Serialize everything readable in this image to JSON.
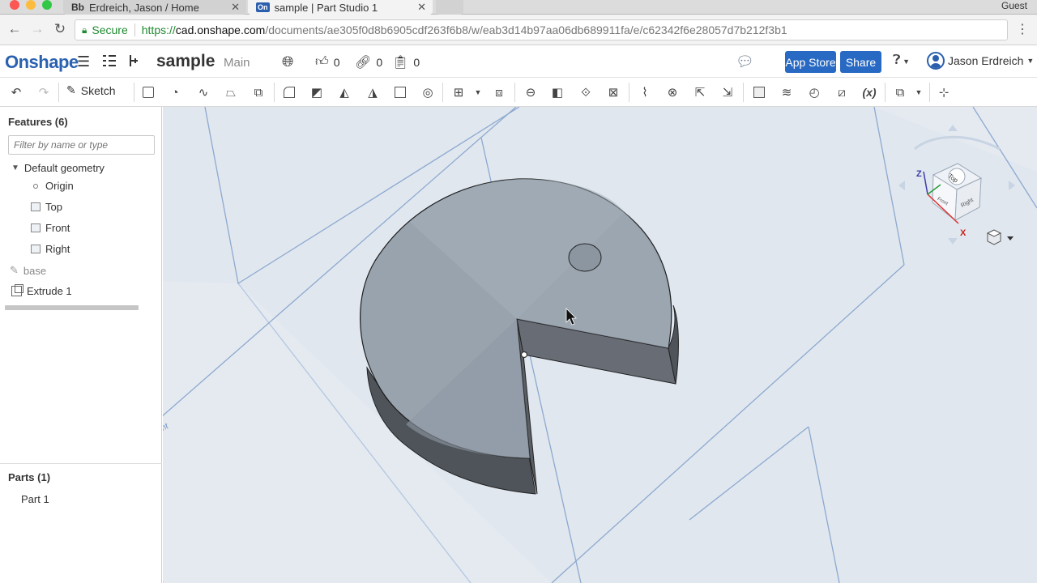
{
  "browser": {
    "tabs": [
      {
        "favicon": "Bb",
        "title": "Erdreich, Jason / Home"
      },
      {
        "favicon": "On",
        "title": "sample | Part Studio 1"
      }
    ],
    "profile": "Guest",
    "secure_label": "Secure",
    "url": {
      "protocol": "https://",
      "host": "cad.onshape.com",
      "path": "/documents/ae305f0d8b6905cdf263f6b8/w/eab3d14b97aa06db689911fa/e/c62342f6e28057d7b212f3b1"
    }
  },
  "app": {
    "logo": "Onshape",
    "document_name": "sample",
    "branch": "Main",
    "likes": "0",
    "links": "0",
    "copies": "0",
    "app_store_label": "App Store",
    "share_label": "Share",
    "user_name": "Jason Erdreich"
  },
  "toolbar": {
    "sketch_label": "Sketch",
    "variable_label": "(x)"
  },
  "features": {
    "header": "Features (6)",
    "filter_placeholder": "Filter by name or type",
    "default_geometry": "Default geometry",
    "origin": "Origin",
    "planes": [
      "Top",
      "Front",
      "Right"
    ],
    "sketch": "base",
    "extrude": "Extrude 1"
  },
  "parts": {
    "header": "Parts (1)",
    "items": [
      "Part 1"
    ]
  },
  "viewcube": {
    "faces": [
      "Top",
      "Front",
      "Right"
    ],
    "axes": [
      "Z",
      "X"
    ]
  },
  "colors": {
    "accent": "#2769c3",
    "part_top": "#98a3ae",
    "part_side": "#5b6068",
    "viewport_bg": "#e5eaf1"
  }
}
